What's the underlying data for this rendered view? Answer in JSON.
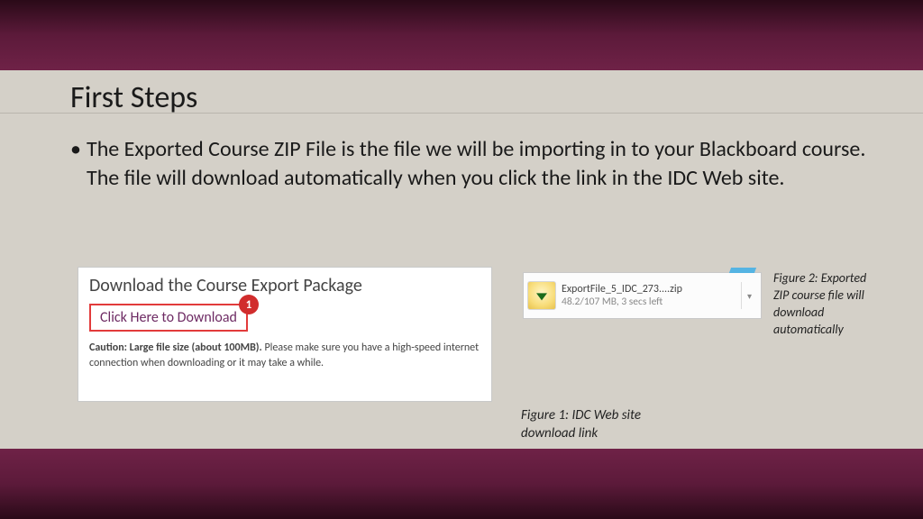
{
  "slide": {
    "title": "First Steps",
    "bullet": "The Exported Course ZIP File is the file we will be importing in to your Blackboard course. The file will download automatically when you click the link in the IDC Web site."
  },
  "figure1": {
    "panel_title": "Download the Course Export Package",
    "link_text": "Click Here to Download",
    "badge": "1",
    "caution_bold": "Caution: Large file size (about 100MB).",
    "caution_rest": " Please make sure you have a high-speed internet connection when downloading or it may take a while.",
    "caption": "Figure 1: IDC Web site download link"
  },
  "figure2": {
    "file_name": "ExportFile_5_IDC_273....zip",
    "progress": "48.2/107 MB, 3 secs left",
    "caption": "Figure 2: Exported ZIP course file will download automatically"
  }
}
